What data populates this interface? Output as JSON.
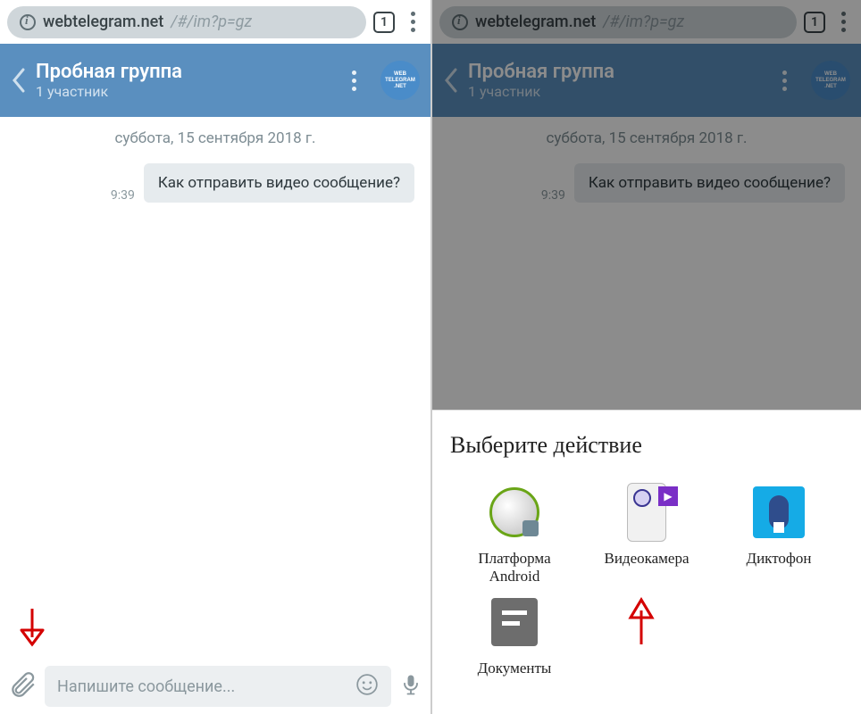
{
  "browser": {
    "url_domain": "webtelegram.net",
    "url_path": "/#/im?p=gz",
    "tabs_count": "1"
  },
  "chat": {
    "title": "Пробная группа",
    "subtitle": "1 участник",
    "avatar_lines": [
      "WEB",
      "TELEGRAM",
      ".NET"
    ],
    "date": "суббота, 15 сентября 2018 г.",
    "message_time": "9:39",
    "message_text": "Как отправить видео сообщение?",
    "input_placeholder": "Напишите сообщение..."
  },
  "sheet": {
    "title": "Выберите действие",
    "items": [
      {
        "label": "Платформа\nAndroid"
      },
      {
        "label": "Видеокамера"
      },
      {
        "label": "Диктофон"
      },
      {
        "label": "Документы"
      }
    ]
  }
}
